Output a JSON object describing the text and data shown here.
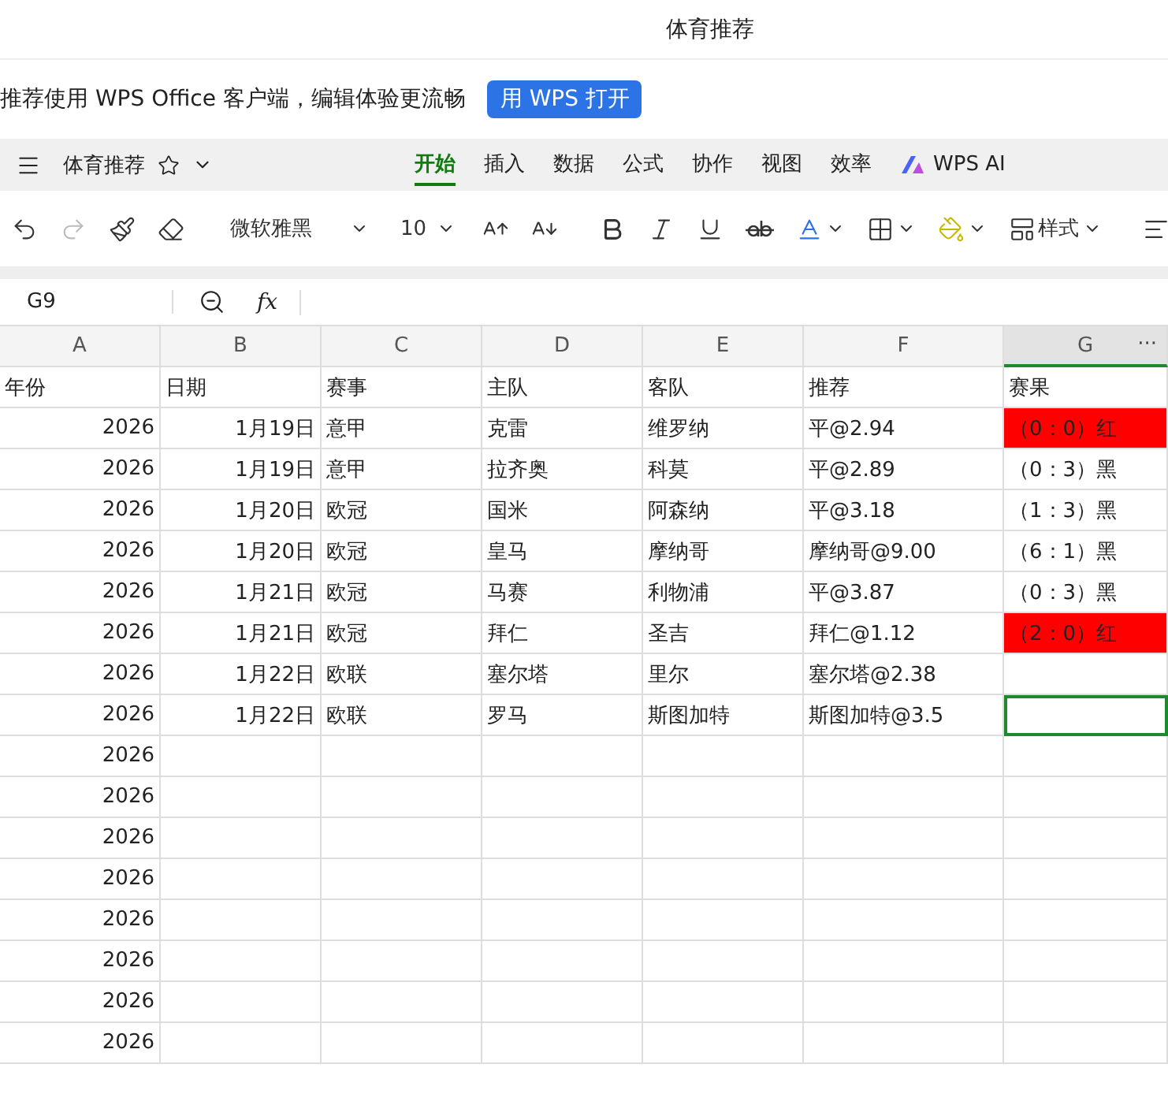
{
  "window": {
    "title": "体育推荐"
  },
  "banner": {
    "text": "推荐使用 WPS Office 客户端，编辑体验更流畅",
    "button": "用 WPS 打开"
  },
  "doc": {
    "name": "体育推荐"
  },
  "tabs": [
    {
      "label": "开始",
      "selected": true
    },
    {
      "label": "插入",
      "selected": false
    },
    {
      "label": "数据",
      "selected": false
    },
    {
      "label": "公式",
      "selected": false
    },
    {
      "label": "协作",
      "selected": false
    },
    {
      "label": "视图",
      "selected": false
    },
    {
      "label": "效率",
      "selected": false
    },
    {
      "label": "WPS AI",
      "selected": false,
      "kind": "ai"
    }
  ],
  "ribbon": {
    "font": "微软雅黑",
    "size": "10",
    "styles": "样式",
    "redo_disabled": true
  },
  "formula_bar": {
    "cell_ref": "G9",
    "fx": "fx"
  },
  "columns": [
    {
      "label": "A",
      "selected": false
    },
    {
      "label": "B",
      "selected": false
    },
    {
      "label": "C",
      "selected": false
    },
    {
      "label": "D",
      "selected": false
    },
    {
      "label": "E",
      "selected": false
    },
    {
      "label": "F",
      "selected": false
    },
    {
      "label": "G",
      "selected": true
    }
  ],
  "column_menu": "···",
  "rows": [
    {
      "cells": [
        "年份",
        "日期",
        "赛事",
        "主队",
        "客队",
        "推荐",
        "赛果"
      ],
      "highlighted": false,
      "selected": false
    },
    {
      "cells": [
        "2026",
        "1月19日",
        "意甲",
        "克雷",
        "维罗纳",
        "平@2.94",
        "（0：0）红"
      ],
      "highlighted": true,
      "selected": false
    },
    {
      "cells": [
        "2026",
        "1月19日",
        "意甲",
        "拉齐奥",
        "科莫",
        "平@2.89",
        "（0：3）黑"
      ],
      "highlighted": false,
      "selected": false
    },
    {
      "cells": [
        "2026",
        "1月20日",
        "欧冠",
        "国米",
        "阿森纳",
        "平@3.18",
        "（1：3）黑"
      ],
      "highlighted": false,
      "selected": false
    },
    {
      "cells": [
        "2026",
        "1月20日",
        "欧冠",
        "皇马",
        "摩纳哥",
        "摩纳哥@9.00",
        "（6：1）黑"
      ],
      "highlighted": false,
      "selected": false
    },
    {
      "cells": [
        "2026",
        "1月21日",
        "欧冠",
        "马赛",
        "利物浦",
        "平@3.87",
        "（0：3）黑"
      ],
      "highlighted": false,
      "selected": false
    },
    {
      "cells": [
        "2026",
        "1月21日",
        "欧冠",
        "拜仁",
        "圣吉",
        "拜仁@1.12",
        "（2：0）红"
      ],
      "highlighted": true,
      "selected": false
    },
    {
      "cells": [
        "2026",
        "1月22日",
        "欧联",
        "塞尔塔",
        "里尔",
        "塞尔塔@2.38",
        ""
      ],
      "highlighted": false,
      "selected": false
    },
    {
      "cells": [
        "2026",
        "1月22日",
        "欧联",
        "罗马",
        "斯图加特",
        "斯图加特@3.5",
        ""
      ],
      "highlighted": false,
      "selected": true
    },
    {
      "cells": [
        "2026",
        "",
        "",
        "",
        "",
        "",
        ""
      ],
      "highlighted": false,
      "selected": false
    },
    {
      "cells": [
        "2026",
        "",
        "",
        "",
        "",
        "",
        ""
      ],
      "highlighted": false,
      "selected": false
    },
    {
      "cells": [
        "2026",
        "",
        "",
        "",
        "",
        "",
        ""
      ],
      "highlighted": false,
      "selected": false
    },
    {
      "cells": [
        "2026",
        "",
        "",
        "",
        "",
        "",
        ""
      ],
      "highlighted": false,
      "selected": false
    },
    {
      "cells": [
        "2026",
        "",
        "",
        "",
        "",
        "",
        ""
      ],
      "highlighted": false,
      "selected": false
    },
    {
      "cells": [
        "2026",
        "",
        "",
        "",
        "",
        "",
        ""
      ],
      "highlighted": false,
      "selected": false
    },
    {
      "cells": [
        "2026",
        "",
        "",
        "",
        "",
        "",
        ""
      ],
      "highlighted": false,
      "selected": false
    },
    {
      "cells": [
        "2026",
        "",
        "",
        "",
        "",
        "",
        ""
      ],
      "highlighted": false,
      "selected": false
    }
  ]
}
